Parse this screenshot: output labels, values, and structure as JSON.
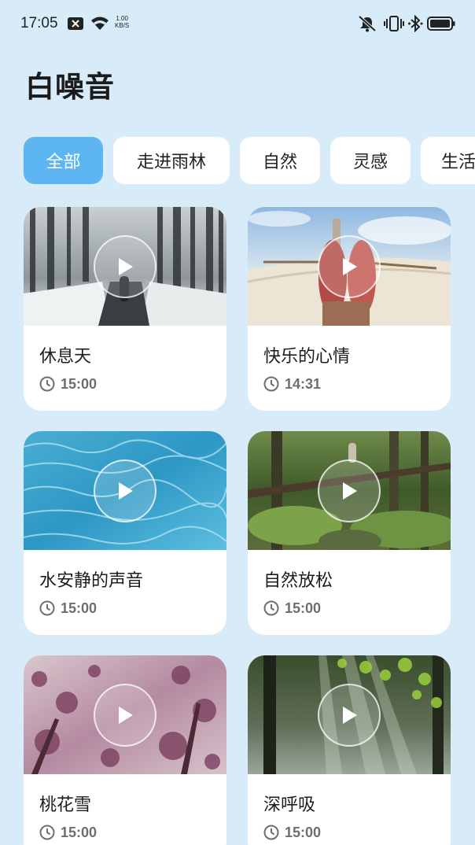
{
  "status_bar": {
    "time": "17:05",
    "net_speed_value": "1.00",
    "net_speed_unit": "KB/S",
    "icons": [
      "notification-badge-icon",
      "wifi-icon",
      "mute-icon",
      "vibrate-icon",
      "bluetooth-icon",
      "battery-icon"
    ]
  },
  "page": {
    "title": "白噪音"
  },
  "tabs": [
    {
      "label": "全部",
      "active": true
    },
    {
      "label": "走进雨林",
      "active": false
    },
    {
      "label": "自然",
      "active": false
    },
    {
      "label": "灵感",
      "active": false
    },
    {
      "label": "生活",
      "active": false
    }
  ],
  "cards": [
    {
      "title": "休息天",
      "duration": "15:00",
      "scene": "snowy-forest-path"
    },
    {
      "title": "快乐的心情",
      "duration": "14:31",
      "scene": "hammock-sky"
    },
    {
      "title": "水安静的声音",
      "duration": "15:00",
      "scene": "pool-water"
    },
    {
      "title": "自然放松",
      "duration": "15:00",
      "scene": "mossy-forest"
    },
    {
      "title": "桃花雪",
      "duration": "15:00",
      "scene": "pink-blossoms"
    },
    {
      "title": "深呼吸",
      "duration": "15:00",
      "scene": "sunlit-forest"
    }
  ],
  "colors": {
    "background": "#d7ecf8",
    "tab_active": "#5db6f2",
    "card": "#ffffff"
  }
}
